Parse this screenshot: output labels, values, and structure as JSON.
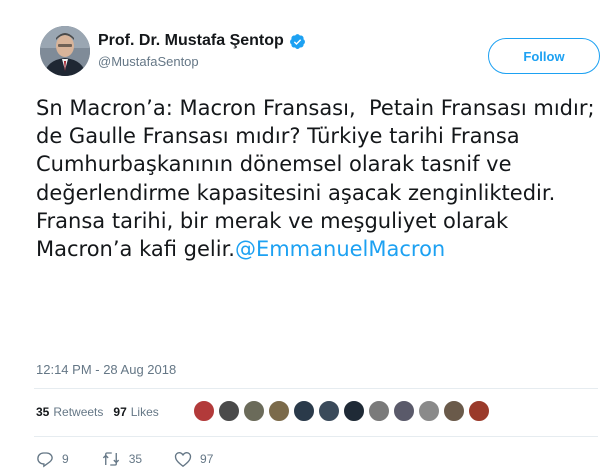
{
  "author": {
    "display_name": "Prof. Dr. Mustafa Şentop",
    "handle": "@MustafaSentop"
  },
  "follow_button": {
    "label": "Follow"
  },
  "tweet": {
    "text": "Sn Macron’a: Macron Fransası,  Petain Fransası mıdır;\nde Gaulle Fransası mıdır? Türkiye tarihi Fransa Cumhurbaşkanının dönemsel olarak tasnif ve değerlendirme kapasitesini aşacak zenginliktedir. Fransa tarihi, bir merak ve meşguliyet olarak Macron’a kafi gelir.",
    "mention": "@EmmanuelMacron",
    "timestamp": "12:14 PM - 28 Aug 2018"
  },
  "stats": {
    "retweets_count": "35",
    "retweets_label": "Retweets",
    "likes_count": "97",
    "likes_label": "Likes"
  },
  "liker_avatar_colors": [
    "#b23a3a",
    "#4a4a4a",
    "#6b6b5a",
    "#7b6a4a",
    "#2a3a4a",
    "#3a4a5a",
    "#1f2a36",
    "#7a7a7a",
    "#5a5a6a",
    "#8a8a8a",
    "#6a5a4a",
    "#9a3a2a"
  ],
  "actions": {
    "reply_count": "9",
    "retweet_count": "35",
    "like_count": "97"
  },
  "colors": {
    "accent": "#1da1f2",
    "secondary_text": "#657786",
    "primary_text": "#14171a"
  }
}
